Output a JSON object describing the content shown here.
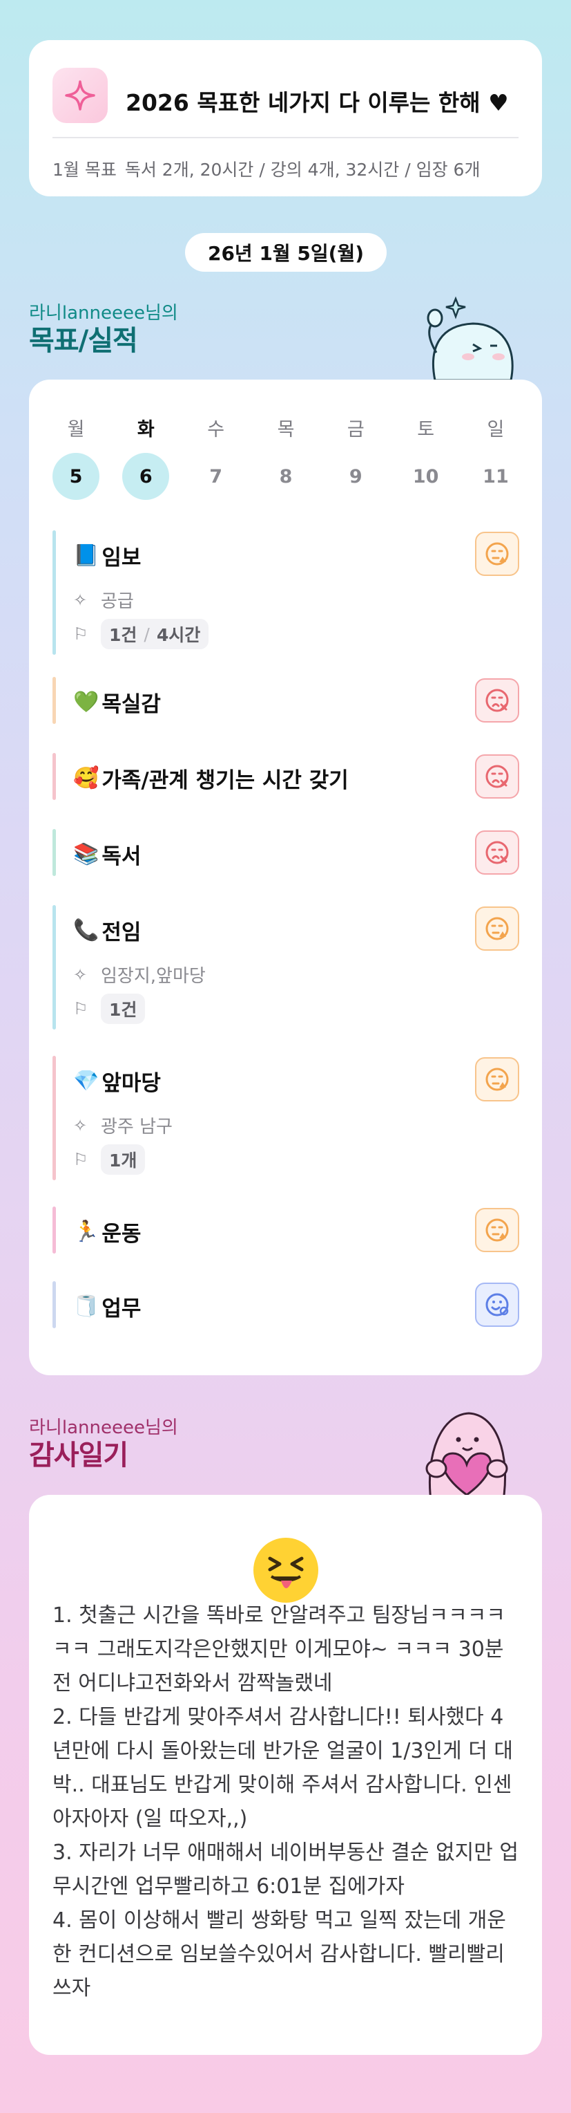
{
  "header": {
    "icon": "sparkle-icon",
    "title": "2026 목표한 네가지 다 이루는 한해 ♥",
    "summary_label": "1월 목표",
    "summary_text": "독서 2개, 20시간 / 강의 4개, 32시간 / 임장 6개"
  },
  "date": "26년 1월 5일(월)",
  "goals_section": {
    "owner": "라니lanneeee님의",
    "title": "목표/실적"
  },
  "week": [
    {
      "day": "월",
      "num": "5",
      "selected": true
    },
    {
      "day": "화",
      "num": "6",
      "selected": true
    },
    {
      "day": "수",
      "num": "7",
      "selected": false
    },
    {
      "day": "목",
      "num": "8",
      "selected": false
    },
    {
      "day": "금",
      "num": "9",
      "selected": false
    },
    {
      "day": "토",
      "num": "10",
      "selected": false
    },
    {
      "day": "일",
      "num": "11",
      "selected": false
    }
  ],
  "goals": [
    {
      "emoji": "📘",
      "name": "임보",
      "sub": "공급",
      "chip_a": "1건",
      "chip_b": "4시간",
      "status": "orange",
      "bar": "#b8e4ee"
    },
    {
      "emoji": "💚",
      "name": "목실감",
      "status": "red",
      "bar": "#f8d6b4"
    },
    {
      "emoji": "🥰",
      "name": " 가족/관계 챙기는 시간 갖기",
      "status": "red",
      "bar": "#f5c4cc"
    },
    {
      "emoji": "📚",
      "name": " 독서",
      "status": "red",
      "bar": "#bfe8dc"
    },
    {
      "emoji": "📞",
      "name": "전임",
      "sub": "임장지,앞마당",
      "chip_a": "1건",
      "status": "orange",
      "bar": "#b8e4ee"
    },
    {
      "emoji": "💎",
      "name": "앞마당",
      "sub": "광주 남구",
      "chip_a": "1개",
      "status": "orange",
      "bar": "#f5c4cc"
    },
    {
      "emoji": "🏃",
      "name": "운동",
      "status": "orange",
      "bar": "#f5bcd6"
    },
    {
      "emoji": "🧻",
      "name": "업무",
      "status": "blue",
      "bar": "#cdd8f0"
    }
  ],
  "thanks_section": {
    "owner": "라니lanneeee님의",
    "title": "감사일기",
    "emoji": "😝",
    "text": "1. 첫출근 시간을 똑바로 안알려주고 팀장님ㅋㅋㅋㅋㅋㅋ 그래도지각은안했지만 이게모야~ ㅋㅋㅋ 30분전 어디냐고전화와서 깜짝놀랬네\n2. 다들 반갑게 맞아주셔서 감사합니다!! 퇴사했다 4년만에 다시 돌아왔는데 반가운 얼굴이 1/3인게 더 대박.. 대표님도 반갑게 맞이해 주셔서 감사합니다. 인센 아자아자 (일 따오자,,)\n3. 자리가 너무 애매해서 네이버부동산 결순 없지만 업무시간엔 업무빨리하고 6:01분 집에가자\n4. 몸이 이상해서 빨리 쌍화탕 먹고 일찍 잤는데 개운한 컨디션으로 임보쓸수있어서 감사합니다. 빨리빨리쓰자"
  },
  "colors": {
    "teal_title": "#0f6f73",
    "pink_title": "#9a1f5a",
    "status_orange": "#f3a44d",
    "status_red": "#e8676f",
    "status_blue": "#5d7fe6"
  }
}
